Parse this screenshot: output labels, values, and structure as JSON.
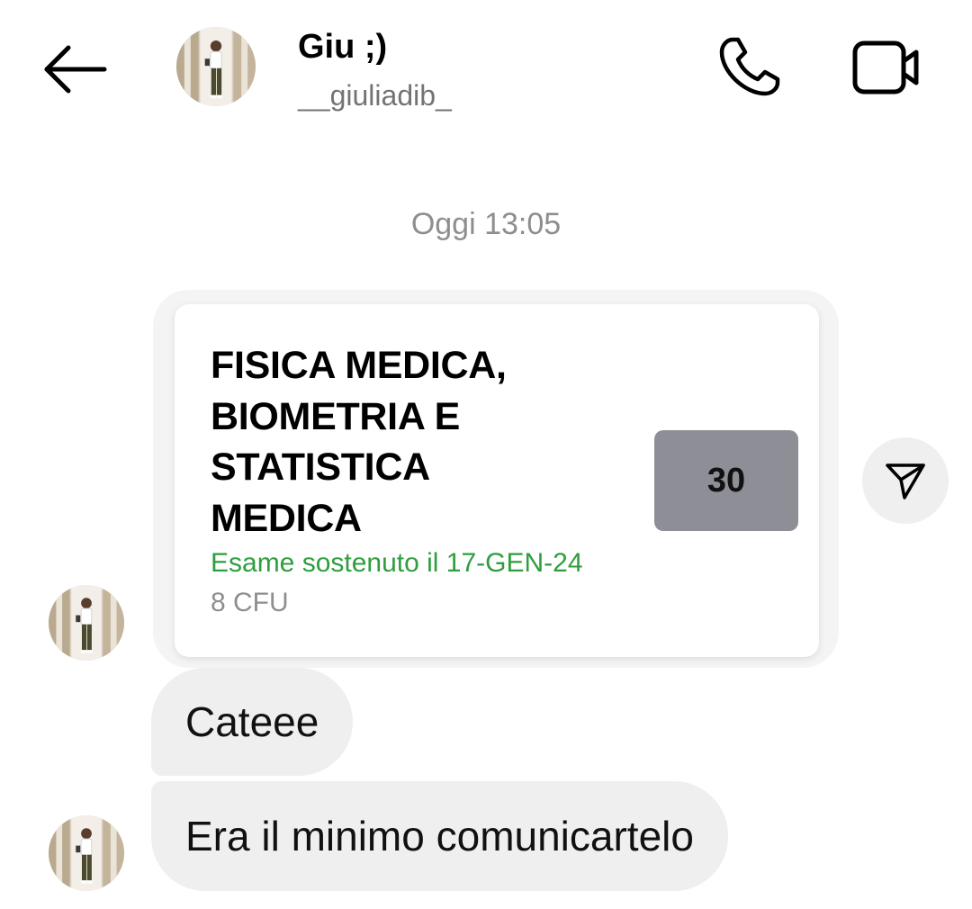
{
  "header": {
    "back_icon": "arrow-left-icon",
    "contact_name": "Giu ;)",
    "contact_username": "__giuliadib_",
    "call_icon": "phone-icon",
    "video_icon": "video-camera-icon"
  },
  "timestamp": "Oggi 13:05",
  "shared_card": {
    "course_title": "FISICA MEDICA,\nBIOMETRIA E\nSTATISTICA\nMEDICA",
    "grade": "30",
    "exam_date": "Esame sostenuto il 17-GEN-24",
    "credits": "8 CFU",
    "date_color": "#2e9e3e",
    "grade_bg_color": "#8e8f96"
  },
  "share_icon": "paper-plane-icon",
  "messages": [
    {
      "text": "Cateee"
    },
    {
      "text": "Era il minimo comunicartelo"
    }
  ],
  "colors": {
    "bubble_bg": "#efefef",
    "secondary_text": "#8e8e8e"
  }
}
